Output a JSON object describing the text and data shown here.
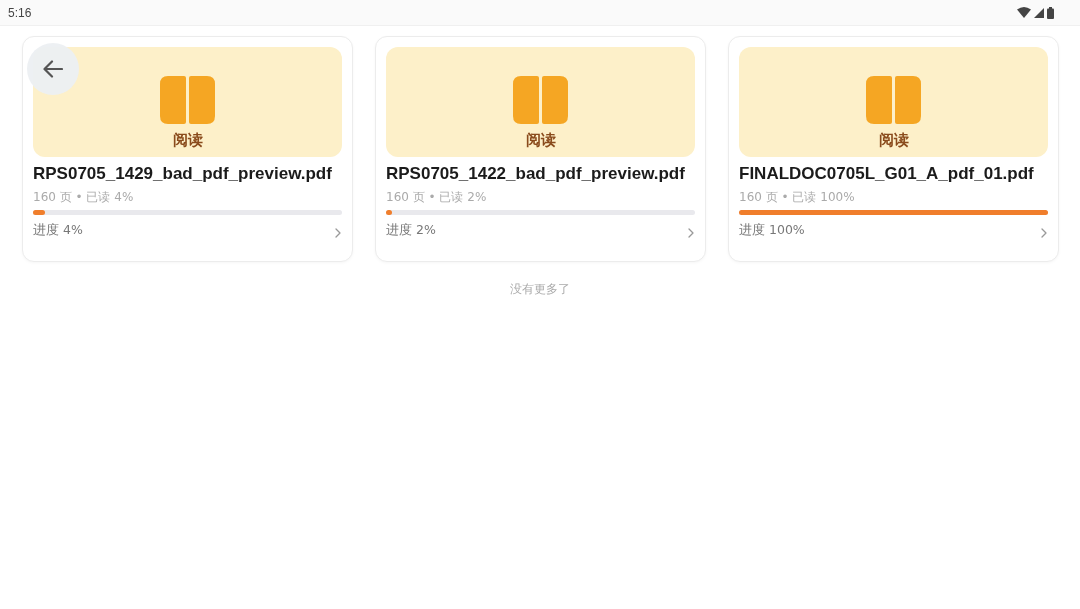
{
  "status_bar": {
    "time": "5:16"
  },
  "documents": [
    {
      "cover_label": "阅读",
      "title": "RPS0705_1429_bad_pdf_preview.pdf",
      "meta": "160 页 • 已读 4%",
      "level": 0.04,
      "progress": "进度 4%"
    },
    {
      "cover_label": "阅读",
      "title": "RPS0705_1422_bad_pdf_preview.pdf",
      "meta": "160 页 • 已读 2%",
      "level": 0.02,
      "progress": "进度 2%"
    },
    {
      "cover_label": "阅读",
      "title": "FINALDOC0705L_G01_A_pdf_01.pdf",
      "meta": "160 页 • 已读 100%",
      "level": 1,
      "progress": "进度 100%"
    }
  ],
  "footer": "没有更多了"
}
